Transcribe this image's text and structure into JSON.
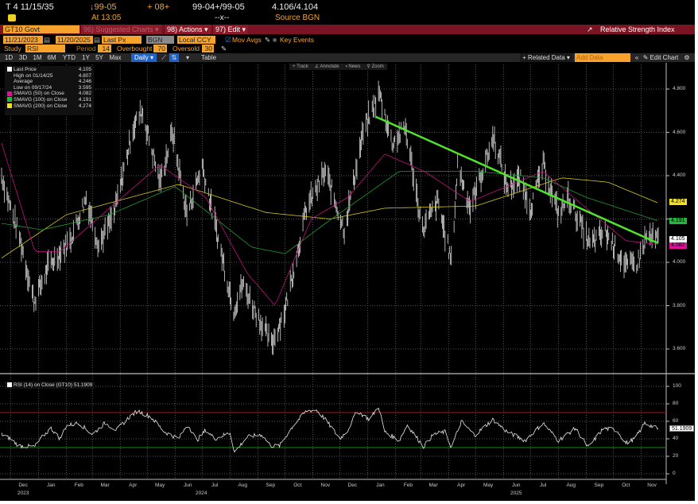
{
  "header": {
    "ticker_line": "T 4 11/15/35",
    "price": "↓99-05",
    "change": "+ 08+",
    "bid_ask": "99-04+/99-05",
    "yield": "4.106/4.104",
    "time": "At 13:05",
    "size": "--x--",
    "source": "Source BGN"
  },
  "menubar": {
    "security": "GT10 Govt",
    "suggested": "96) Suggested Charts ▾",
    "actions": "98) Actions ▾",
    "edit": "97) Edit ▾",
    "title": "Relative Strength Index"
  },
  "controls": {
    "start_date": "11/21/2023",
    "end_date": "11/20/2025",
    "field": "Last Px",
    "source": "BGN",
    "currency": "Local CCY",
    "mov_avgs": "Mov Avgs",
    "key_events": "Key Events",
    "study_label": "Study",
    "study": "RSI",
    "period_label": "Period",
    "period": "14",
    "overbought_label": "Overbought",
    "overbought": "70",
    "oversold_label": "Oversold",
    "oversold": "30"
  },
  "toolbar": {
    "ranges": [
      "1D",
      "3D",
      "1M",
      "6M",
      "YTD",
      "1Y",
      "5Y",
      "Max"
    ],
    "frequency": "Daily ▾",
    "table": "Table",
    "related": "+ Related Data ▾",
    "add_data_placeholder": "Add Data",
    "edit_chart": "Edit Chart",
    "track": "+ Track",
    "annotate": "∠ Annotate",
    "news": "News",
    "zoom": "Zoom"
  },
  "legend": [
    {
      "label": "Last Price",
      "value": "4.105",
      "color": "#ffffff"
    },
    {
      "label": "High on 01/14/25",
      "value": "4.807"
    },
    {
      "label": "Average",
      "value": "4.246"
    },
    {
      "label": "Low on 09/17/24",
      "value": "3.595"
    },
    {
      "label": "SMAVG (50)  on Close",
      "value": "4.082",
      "color": "#e0109a"
    },
    {
      "label": "SMAVG (100)  on Close",
      "value": "4.191",
      "color": "#22b83a"
    },
    {
      "label": "SMAVG (200)  on Close",
      "value": "4.274",
      "color": "#f0e020"
    }
  ],
  "rsi_legend": "RSI (14)  on Close (GT10) 51.1909",
  "chart_data": [
    {
      "type": "line",
      "title": "GT10 Govt Last Price (daily bars)",
      "start": "2023-11-21",
      "end": "2025-11-20",
      "ylim": [
        3.5,
        4.88
      ],
      "yticks": [
        "4.800",
        "4.600",
        "4.400",
        "4.200",
        "4.000",
        "3.800",
        "3.600"
      ],
      "price_points": [
        [
          "2023-11-21",
          4.4
        ],
        [
          "2023-12-01",
          4.25
        ],
        [
          "2023-12-12",
          4.1
        ],
        [
          "2023-12-27",
          3.82
        ],
        [
          "2024-01-12",
          3.98
        ],
        [
          "2024-02-05",
          4.1
        ],
        [
          "2024-02-23",
          4.3
        ],
        [
          "2024-03-08",
          4.08
        ],
        [
          "2024-03-25",
          4.22
        ],
        [
          "2024-04-15",
          4.62
        ],
        [
          "2024-04-25",
          4.7
        ],
        [
          "2024-05-15",
          4.37
        ],
        [
          "2024-05-29",
          4.6
        ],
        [
          "2024-06-14",
          4.22
        ],
        [
          "2024-07-01",
          4.45
        ],
        [
          "2024-07-15",
          4.18
        ],
        [
          "2024-08-05",
          3.78
        ],
        [
          "2024-08-15",
          3.9
        ],
        [
          "2024-09-16",
          3.62
        ],
        [
          "2024-10-01",
          3.78
        ],
        [
          "2024-10-25",
          4.25
        ],
        [
          "2024-11-15",
          4.42
        ],
        [
          "2024-12-06",
          4.15
        ],
        [
          "2024-12-27",
          4.6
        ],
        [
          "2025-01-14",
          4.78
        ],
        [
          "2025-01-28",
          4.55
        ],
        [
          "2025-02-12",
          4.62
        ],
        [
          "2025-03-03",
          4.15
        ],
        [
          "2025-03-20",
          4.28
        ],
        [
          "2025-04-04",
          4.0
        ],
        [
          "2025-04-11",
          4.45
        ],
        [
          "2025-04-25",
          4.25
        ],
        [
          "2025-05-21",
          4.58
        ],
        [
          "2025-06-05",
          4.35
        ],
        [
          "2025-06-20",
          4.38
        ],
        [
          "2025-07-01",
          4.25
        ],
        [
          "2025-07-15",
          4.45
        ],
        [
          "2025-08-01",
          4.22
        ],
        [
          "2025-08-12",
          4.3
        ],
        [
          "2025-09-05",
          4.08
        ],
        [
          "2025-09-22",
          4.14
        ],
        [
          "2025-10-16",
          3.98
        ],
        [
          "2025-10-28",
          4.0
        ],
        [
          "2025-11-07",
          4.12
        ],
        [
          "2025-11-20",
          4.105
        ]
      ],
      "sma50": [
        [
          "2023-11-21",
          4.55
        ],
        [
          "2023-12-28",
          4.05
        ],
        [
          "2024-01-25",
          4.05
        ],
        [
          "2024-03-20",
          4.25
        ],
        [
          "2024-05-15",
          4.45
        ],
        [
          "2024-07-05",
          4.3
        ],
        [
          "2024-08-20",
          3.95
        ],
        [
          "2024-09-20",
          3.8
        ],
        [
          "2024-10-30",
          4.2
        ],
        [
          "2024-12-10",
          4.3
        ],
        [
          "2025-01-20",
          4.5
        ],
        [
          "2025-03-05",
          4.42
        ],
        [
          "2025-04-25",
          4.28
        ],
        [
          "2025-07-15",
          4.42
        ],
        [
          "2025-09-01",
          4.25
        ],
        [
          "2025-10-15",
          4.1
        ],
        [
          "2025-11-20",
          4.082
        ]
      ],
      "sma100": [
        [
          "2023-11-21",
          4.18
        ],
        [
          "2024-01-05",
          4.15
        ],
        [
          "2024-03-20",
          4.22
        ],
        [
          "2024-06-01",
          4.35
        ],
        [
          "2024-08-25",
          4.07
        ],
        [
          "2024-10-01",
          4.04
        ],
        [
          "2024-11-15",
          4.18
        ],
        [
          "2025-02-05",
          4.42
        ],
        [
          "2025-05-01",
          4.42
        ],
        [
          "2025-07-15",
          4.39
        ],
        [
          "2025-09-01",
          4.3
        ],
        [
          "2025-11-20",
          4.191
        ]
      ],
      "sma200": [
        [
          "2023-11-21",
          4.02
        ],
        [
          "2024-02-01",
          4.22
        ],
        [
          "2024-06-05",
          4.36
        ],
        [
          "2024-09-10",
          4.23
        ],
        [
          "2024-11-20",
          4.2
        ],
        [
          "2025-01-20",
          4.25
        ],
        [
          "2025-05-01",
          4.26
        ],
        [
          "2025-08-05",
          4.39
        ],
        [
          "2025-09-25",
          4.37
        ],
        [
          "2025-11-20",
          4.274
        ]
      ],
      "trendline": [
        [
          "2025-01-10",
          4.672
        ],
        [
          "2025-11-20",
          4.088
        ]
      ],
      "last_tags": [
        {
          "label": "4.274",
          "color": "#f0e020"
        },
        {
          "label": "4.191",
          "color": "#22b83a"
        },
        {
          "label": "4.105",
          "color": "#ffffff"
        },
        {
          "label": "4.082",
          "color": "#e0109a"
        }
      ]
    },
    {
      "type": "line",
      "title": "RSI (14) on Close (GT10)",
      "ylim": [
        -5,
        110
      ],
      "yticks": [
        "100",
        "80",
        "60",
        "40",
        "20",
        "0"
      ],
      "overbought": 70,
      "oversold": 30,
      "last": "51.1909",
      "rsi_points": [
        [
          "2023-11-21",
          45
        ],
        [
          "2023-12-01",
          40
        ],
        [
          "2023-12-10",
          32
        ],
        [
          "2023-12-28",
          31
        ],
        [
          "2024-01-05",
          42
        ],
        [
          "2024-01-15",
          52
        ],
        [
          "2024-01-25",
          40
        ],
        [
          "2024-02-01",
          55
        ],
        [
          "2024-02-15",
          58
        ],
        [
          "2024-03-01",
          45
        ],
        [
          "2024-03-15",
          58
        ],
        [
          "2024-03-28",
          50
        ],
        [
          "2024-04-10",
          64
        ],
        [
          "2024-04-20",
          72
        ],
        [
          "2024-05-05",
          65
        ],
        [
          "2024-05-20",
          48
        ],
        [
          "2024-06-05",
          40
        ],
        [
          "2024-06-15",
          57
        ],
        [
          "2024-06-25",
          38
        ],
        [
          "2024-07-05",
          50
        ],
        [
          "2024-07-15",
          40
        ],
        [
          "2024-08-01",
          47
        ],
        [
          "2024-08-06",
          25
        ],
        [
          "2024-08-20",
          42
        ],
        [
          "2024-09-05",
          45
        ],
        [
          "2024-09-15",
          32
        ],
        [
          "2024-09-25",
          32
        ],
        [
          "2024-10-10",
          55
        ],
        [
          "2024-10-25",
          72
        ],
        [
          "2024-11-05",
          73
        ],
        [
          "2024-11-15",
          62
        ],
        [
          "2024-12-01",
          40
        ],
        [
          "2024-12-10",
          50
        ],
        [
          "2024-12-20",
          72
        ],
        [
          "2025-01-03",
          62
        ],
        [
          "2025-01-13",
          77
        ],
        [
          "2025-01-20",
          48
        ],
        [
          "2025-02-05",
          38
        ],
        [
          "2025-02-14",
          56
        ],
        [
          "2025-03-04",
          31
        ],
        [
          "2025-03-15",
          45
        ],
        [
          "2025-03-28",
          48
        ],
        [
          "2025-04-04",
          30
        ],
        [
          "2025-04-15",
          60
        ],
        [
          "2025-04-30",
          44
        ],
        [
          "2025-05-20",
          62
        ],
        [
          "2025-06-05",
          48
        ],
        [
          "2025-06-25",
          38
        ],
        [
          "2025-07-15",
          58
        ],
        [
          "2025-08-01",
          38
        ],
        [
          "2025-08-20",
          52
        ],
        [
          "2025-09-03",
          30
        ],
        [
          "2025-09-20",
          52
        ],
        [
          "2025-10-05",
          50
        ],
        [
          "2025-10-15",
          35
        ],
        [
          "2025-10-25",
          40
        ],
        [
          "2025-11-05",
          58
        ],
        [
          "2025-11-20",
          51.19
        ]
      ]
    },
    {
      "type": "axis",
      "months": [
        [
          "Dec",
          "2023-12-15"
        ],
        [
          "Jan",
          "2024-01-15"
        ],
        [
          "Feb",
          "2024-02-15"
        ],
        [
          "Mar",
          "2024-03-15"
        ],
        [
          "Apr",
          "2024-04-15"
        ],
        [
          "May",
          "2024-05-15"
        ],
        [
          "Jun",
          "2024-06-15"
        ],
        [
          "Jul",
          "2024-07-15"
        ],
        [
          "Aug",
          "2024-08-15"
        ],
        [
          "Sep",
          "2024-09-15"
        ],
        [
          "Oct",
          "2024-10-15"
        ],
        [
          "Nov",
          "2024-11-15"
        ],
        [
          "Dec",
          "2024-12-15"
        ],
        [
          "Jan",
          "2025-01-15"
        ],
        [
          "Feb",
          "2025-02-15"
        ],
        [
          "Mar",
          "2025-03-15"
        ],
        [
          "Apr",
          "2025-04-15"
        ],
        [
          "May",
          "2025-05-15"
        ],
        [
          "Jun",
          "2025-06-15"
        ],
        [
          "Jul",
          "2025-07-15"
        ],
        [
          "Aug",
          "2025-08-15"
        ],
        [
          "Sep",
          "2025-09-15"
        ],
        [
          "Oct",
          "2025-10-15"
        ],
        [
          "Nov",
          "2025-11-13"
        ]
      ],
      "years": [
        [
          "2023",
          "2023-12-15"
        ],
        [
          "2024",
          "2024-06-30"
        ],
        [
          "2025",
          "2025-06-15"
        ]
      ]
    }
  ]
}
